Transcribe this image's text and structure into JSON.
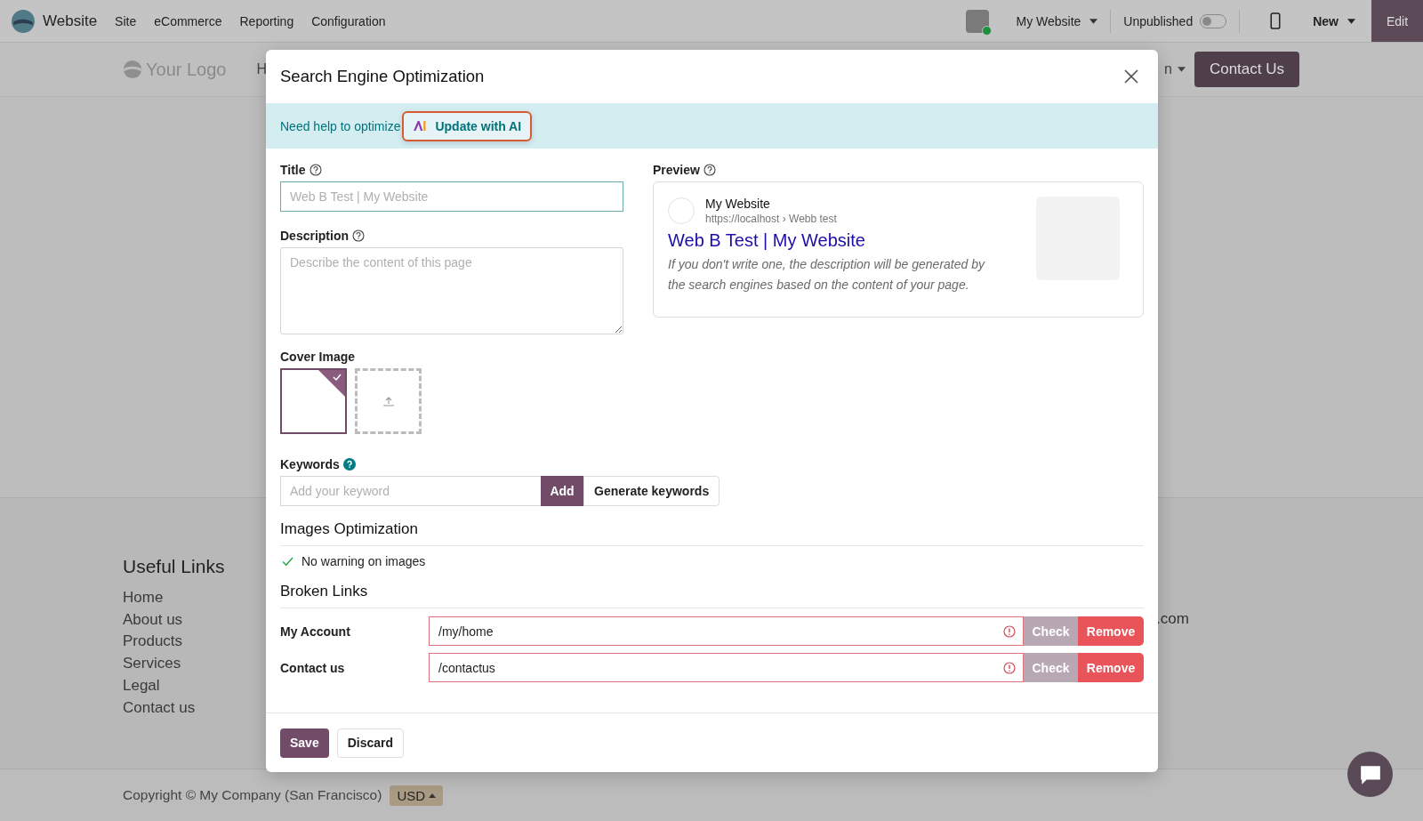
{
  "top_bar": {
    "app": "Website",
    "menu": [
      "Site",
      "eCommerce",
      "Reporting",
      "Configuration"
    ],
    "website_switcher": "My Website",
    "publish": {
      "label": "Unpublished",
      "on": false
    },
    "new_button": "New",
    "edit_button": "Edit"
  },
  "site_header": {
    "logo": "Your Logo",
    "nav_fragment_left": "H",
    "nav_fragment_right": "n",
    "contact_button": "Contact Us"
  },
  "footer": {
    "heading": "Useful Links",
    "links": [
      "Home",
      "About us",
      "Products",
      "Services",
      "Legal",
      "Contact us"
    ],
    "fragment": ".com",
    "copyright": "Copyright © My Company (San Francisco)",
    "currency": "USD"
  },
  "dialog": {
    "title": "Search Engine Optimization",
    "ai_banner": {
      "text": "Need help to optimize",
      "button": "Update with AI"
    },
    "title_field": {
      "label": "Title",
      "placeholder": "Web B Test | My Website"
    },
    "description_field": {
      "label": "Description",
      "placeholder": "Describe the content of this page"
    },
    "preview": {
      "label": "Preview",
      "site_name": "My Website",
      "url": "https://localhost › Webb test",
      "title": "Web B Test | My Website",
      "description": "If you don't write one, the description will be generated by the search engines based on the content of your page."
    },
    "cover_image": {
      "label": "Cover Image",
      "images": [
        {
          "kind": "logo",
          "selected": true
        },
        {
          "kind": "upload",
          "selected": false
        }
      ]
    },
    "keywords": {
      "label": "Keywords",
      "placeholder": "Add your keyword",
      "add_button": "Add",
      "generate_button": "Generate keywords"
    },
    "images_optimization": {
      "heading": "Images Optimization",
      "status": "No warning on images"
    },
    "broken_links": {
      "heading": "Broken Links",
      "rows": [
        {
          "label": "My Account",
          "value": "/my/home",
          "check_button": "Check",
          "remove_button": "Remove"
        },
        {
          "label": "Contact us",
          "value": "/contactus",
          "check_button": "Check",
          "remove_button": "Remove"
        }
      ]
    },
    "save_button": "Save",
    "discard_button": "Discard"
  }
}
